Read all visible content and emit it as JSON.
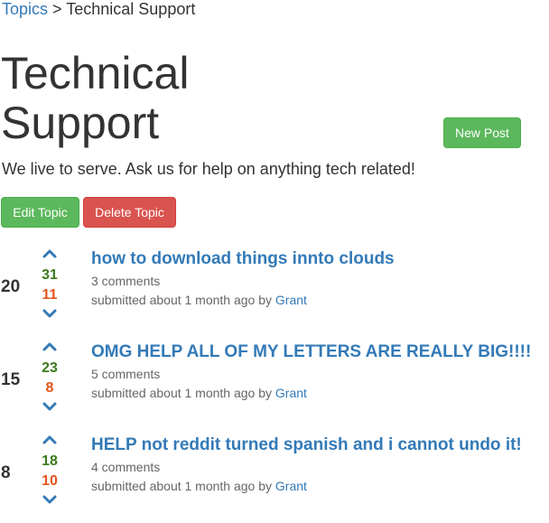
{
  "breadcrumb": {
    "topics_label": "Topics",
    "separator": ">",
    "current": "Technical Support"
  },
  "topic": {
    "title": "Technical Support",
    "description": "We live to serve. Ask us for help on anything tech related!"
  },
  "buttons": {
    "new_post": "New Post",
    "edit_topic": "Edit Topic",
    "delete_topic": "Delete Topic"
  },
  "icons": {
    "upvote": "chevron-up-icon",
    "downvote": "chevron-down-icon"
  },
  "colors": {
    "link": "#337ab7",
    "success": "#5cb85c",
    "danger": "#d9534f",
    "upvote_count": "#3c7a1e",
    "downvote_count": "#e2541b"
  },
  "posts": [
    {
      "score": "20",
      "upvotes": "31",
      "downvotes": "11",
      "title": "how to download things innto clouds",
      "comments": "3 comments",
      "submitted_prefix": "submitted about 1 month ago by",
      "author": "Grant"
    },
    {
      "score": "15",
      "upvotes": "23",
      "downvotes": "8",
      "title": "OMG HELP ALL OF MY LETTERS ARE REALLY BIG!!!!",
      "comments": "5 comments",
      "submitted_prefix": "submitted about 1 month ago by",
      "author": "Grant"
    },
    {
      "score": "8",
      "upvotes": "18",
      "downvotes": "10",
      "title": "HELP not reddit turned spanish and i cannot undo it!",
      "comments": "4 comments",
      "submitted_prefix": "submitted about 1 month ago by",
      "author": "Grant"
    }
  ]
}
